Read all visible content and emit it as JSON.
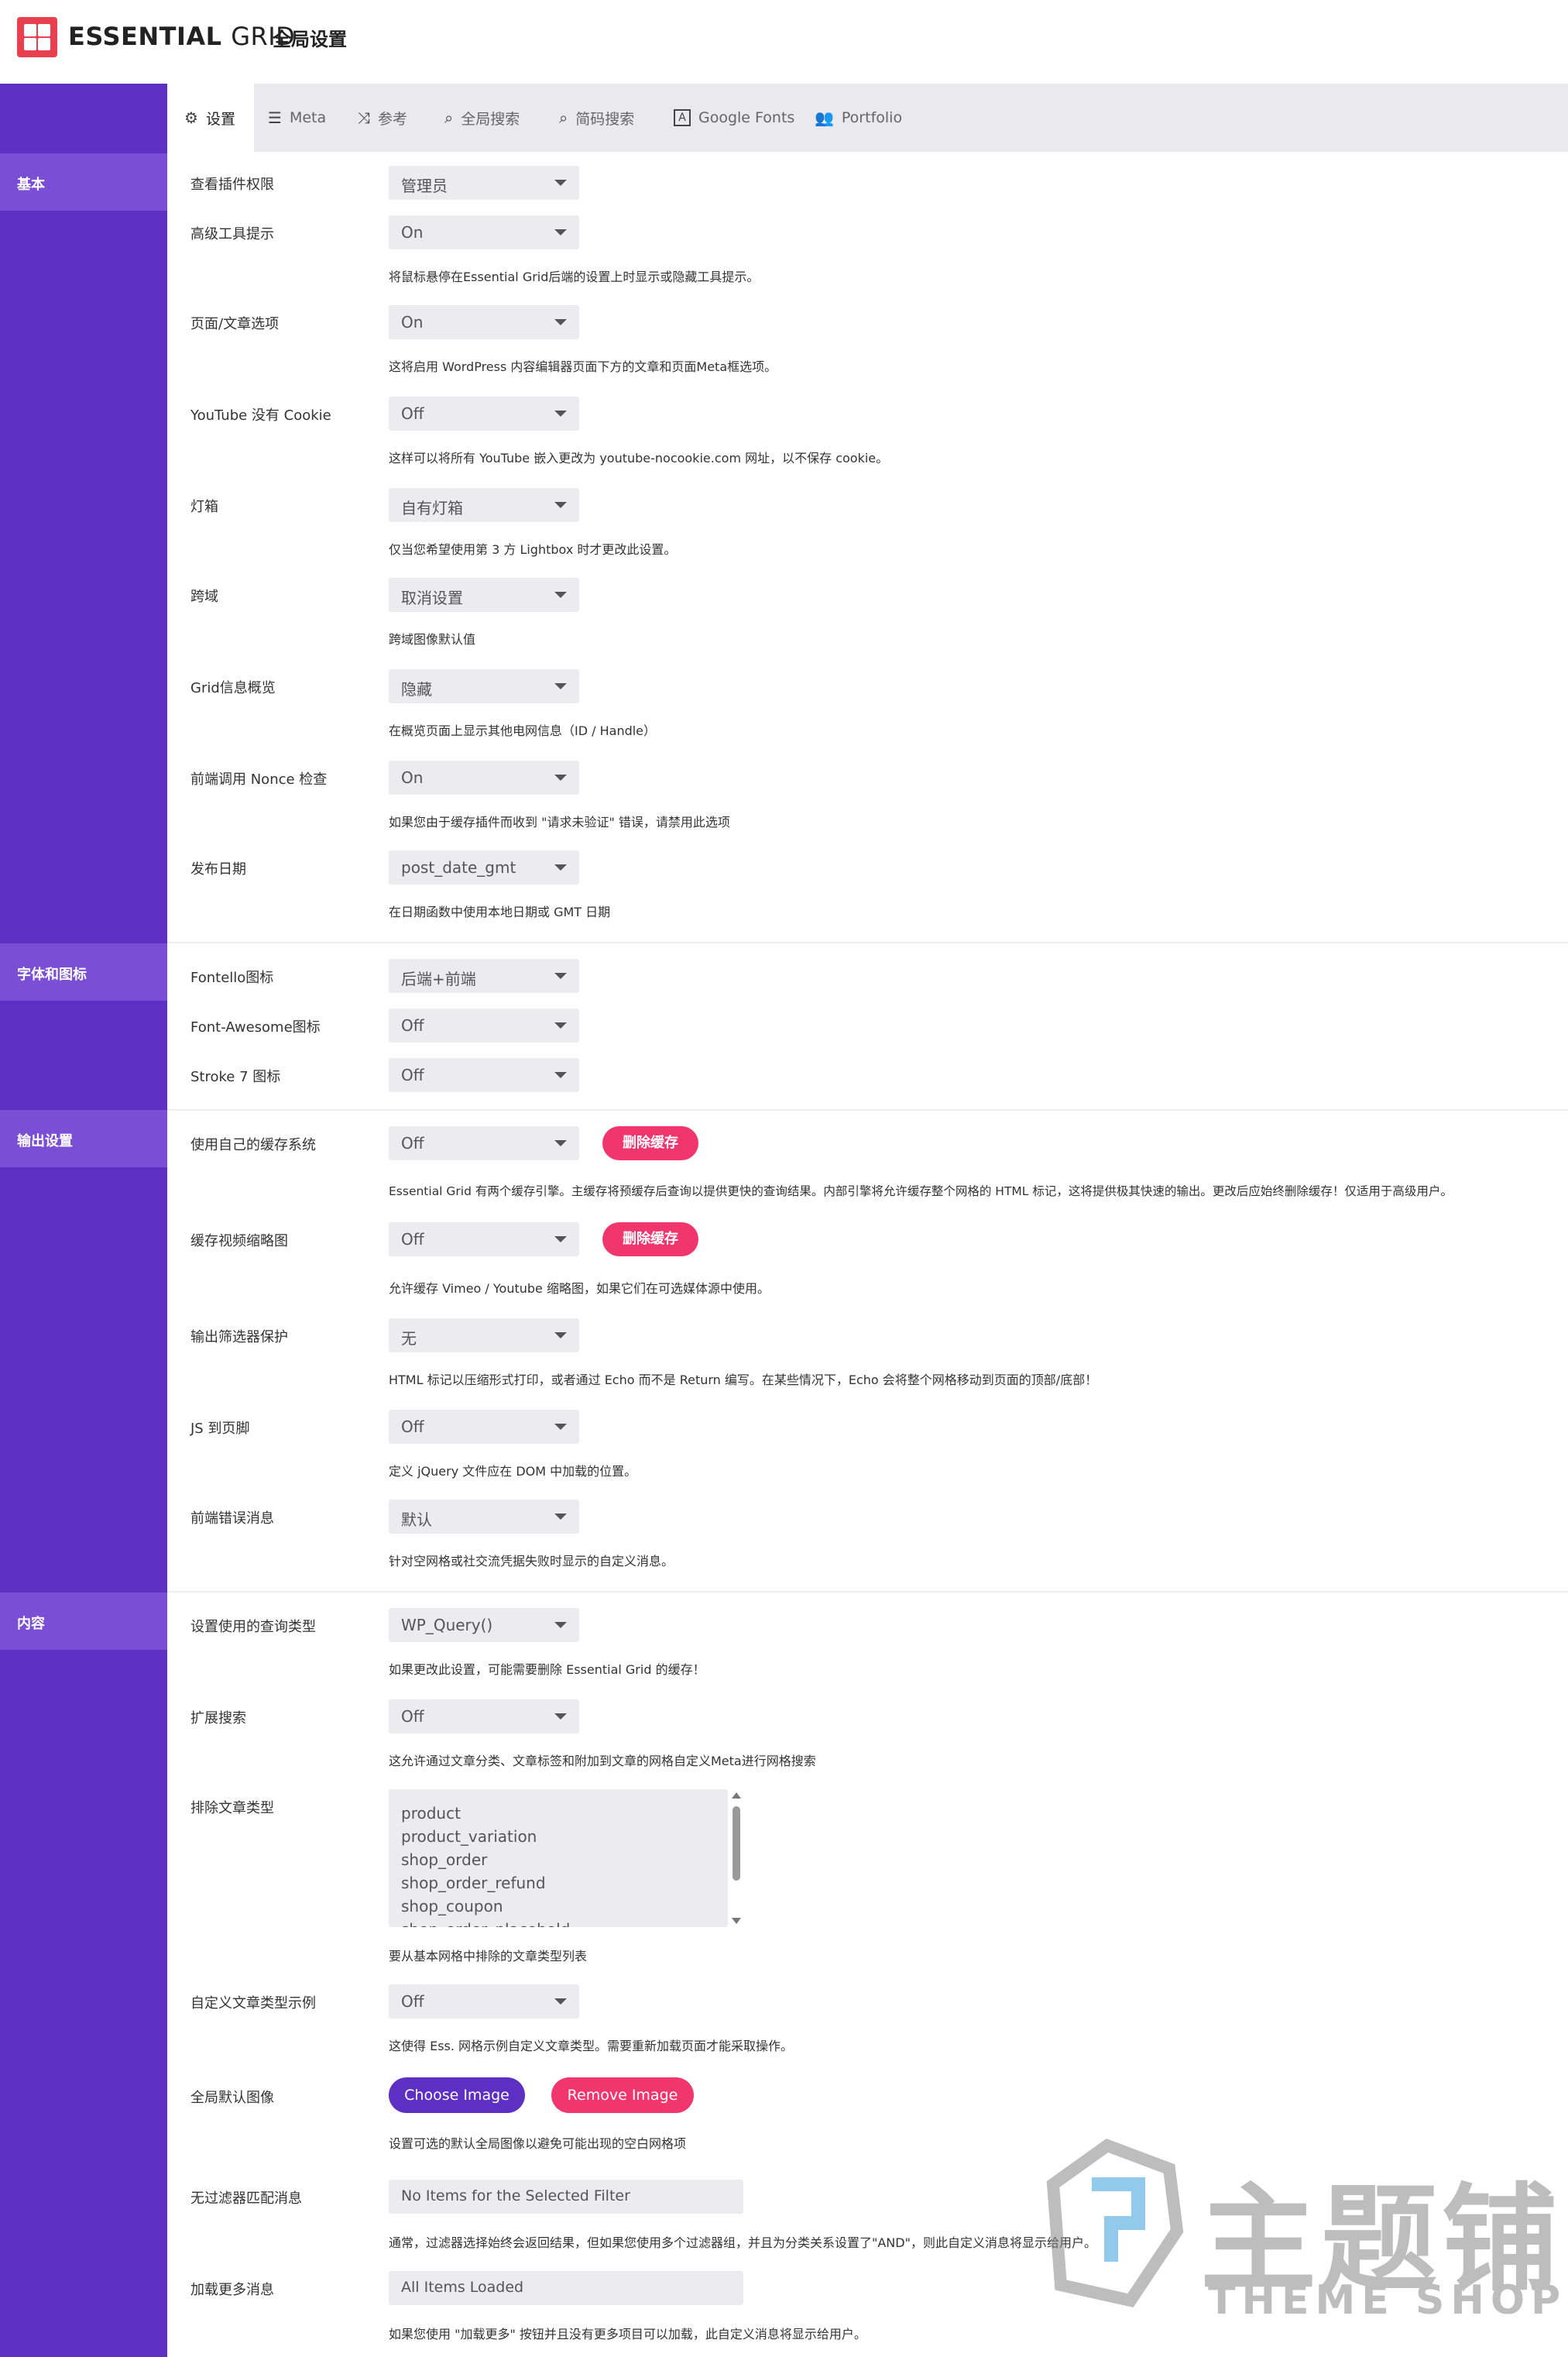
{
  "header": {
    "logo_bold": "ESSENTIAL",
    "logo_thin": "GRID",
    "title": "全局设置",
    "logo_icon": "grid-icon",
    "accent_color": "#e8404e"
  },
  "tabs": [
    {
      "icon": "gear-icon",
      "label": "设置",
      "active": true
    },
    {
      "icon": "menu-icon",
      "label": "Meta"
    },
    {
      "icon": "shuffle-icon",
      "label": "参考"
    },
    {
      "icon": "search-icon",
      "label": "全局搜索"
    },
    {
      "icon": "search-icon",
      "label": "简码搜索"
    },
    {
      "icon": "font-icon",
      "label": "Google Fonts"
    },
    {
      "icon": "users-icon",
      "label": "Portfolio"
    }
  ],
  "sections": {
    "basic": "基本",
    "fonts": "字体和图标",
    "output": "输出设置",
    "content": "内容"
  },
  "basic": [
    {
      "label": "查看插件权限",
      "value": "管理员",
      "desc": ""
    },
    {
      "label": "高级工具提示",
      "value": "On",
      "desc": "将鼠标悬停在Essential Grid后端的设置上时显示或隐藏工具提示。"
    },
    {
      "label": "页面/文章选项",
      "value": "On",
      "desc": "这将启用 WordPress 内容编辑器页面下方的文章和页面Meta框选项。"
    },
    {
      "label": "YouTube 没有 Cookie",
      "value": "Off",
      "desc": "这样可以将所有 YouTube 嵌入更改为 youtube-nocookie.com 网址，以不保存 cookie。"
    },
    {
      "label": "灯箱",
      "value": "自有灯箱",
      "desc": "仅当您希望使用第 3 方 Lightbox 时才更改此设置。"
    },
    {
      "label": "跨域",
      "value": "取消设置",
      "desc": "跨域图像默认值"
    },
    {
      "label": "Grid信息概览",
      "value": "隐藏",
      "desc": "在概览页面上显示其他电网信息（ID / Handle）"
    },
    {
      "label": "前端调用 Nonce 检查",
      "value": "On",
      "desc": "如果您由于缓存插件而收到 \"请求未验证\" 错误，请禁用此选项"
    },
    {
      "label": "发布日期",
      "value": "post_date_gmt",
      "desc": "在日期函数中使用本地日期或 GMT 日期"
    }
  ],
  "fonts": [
    {
      "label": "Fontello图标",
      "value": "后端+前端"
    },
    {
      "label": "Font-Awesome图标",
      "value": "Off"
    },
    {
      "label": "Stroke 7 图标",
      "value": "Off"
    }
  ],
  "output": [
    {
      "label": "使用自己的缓存系统",
      "value": "Off",
      "button": "删除缓存",
      "desc": "Essential Grid 有两个缓存引擎。主缓存将预缓存后查询以提供更快的查询结果。内部引擎将允许缓存整个网格的 HTML 标记，这将提供极其快速的输出。更改后应始终删除缓存！仅适用于高级用户。"
    },
    {
      "label": "缓存视频缩略图",
      "value": "Off",
      "button": "删除缓存",
      "desc": "允许缓存 Vimeo / Youtube 缩略图，如果它们在可选媒体源中使用。"
    },
    {
      "label": "输出筛选器保护",
      "value": "无",
      "desc": "HTML 标记以压缩形式打印，或者通过 Echo 而不是 Return 编写。在某些情况下，Echo 会将整个网格移动到页面的顶部/底部！"
    },
    {
      "label": "JS 到页脚",
      "value": "Off",
      "desc": "定义 jQuery 文件应在 DOM 中加载的位置。"
    },
    {
      "label": "前端错误消息",
      "value": "默认",
      "desc": "针对空网格或社交流凭据失败时显示的自定义消息。"
    }
  ],
  "content": {
    "query_type": {
      "label": "设置使用的查询类型",
      "value": "WP_Query()",
      "desc": "如果更改此设置，可能需要删除 Essential Grid 的缓存！"
    },
    "ext_search": {
      "label": "扩展搜索",
      "value": "Off",
      "desc": "这允许通过文章分类、文章标签和附加到文章的网格自定义Meta进行网格搜索"
    },
    "exclude_types": {
      "label": "排除文章类型",
      "options": [
        "product",
        "product_variation",
        "shop_order",
        "shop_order_refund",
        "shop_coupon",
        "shop_order_placehold"
      ],
      "desc": "要从基本网格中排除的文章类型列表"
    },
    "custom_type": {
      "label": "自定义文章类型示例",
      "value": "Off",
      "desc": "这使得 Ess. 网格示例自定义文章类型。需要重新加载页面才能采取操作。"
    },
    "default_image": {
      "label": "全局默认图像",
      "choose": "Choose Image",
      "remove": "Remove Image",
      "desc": "设置可选的默认全局图像以避免可能出现的空白网格项"
    },
    "no_filter": {
      "label": "无过滤器匹配消息",
      "value": "No Items for the Selected Filter",
      "desc": "通常，过滤器选择始终会返回结果，但如果您使用多个过滤器组，并且为分类关系设置了\"AND\"，则此自定义消息将显示给用户。"
    },
    "load_more": {
      "label": "加载更多消息",
      "value": "All Items Loaded",
      "desc": "如果您使用 \"加载更多\" 按钮并且没有更多项目可以加载，此自定义消息将显示给用户。"
    }
  },
  "watermark": {
    "cn": "主题铺",
    "en": "THEME SHOP"
  }
}
